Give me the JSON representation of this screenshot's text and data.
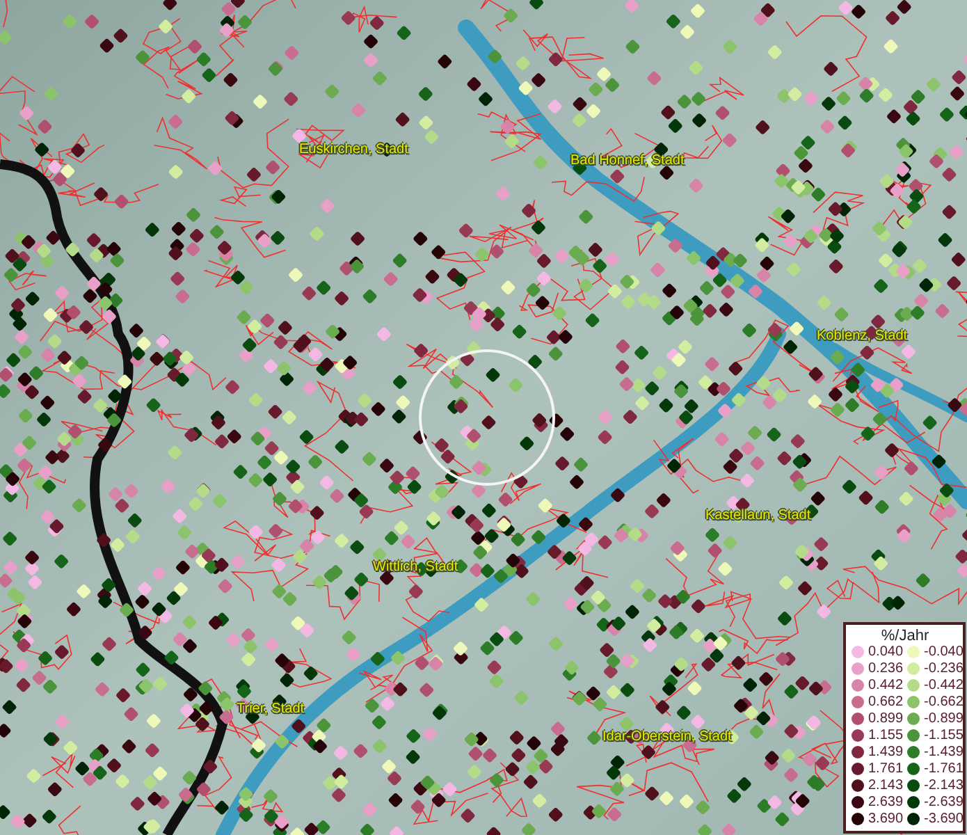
{
  "map": {
    "places": [
      {
        "name": "Euskirchen, Stadt"
      },
      {
        "name": "Bad Honnef, Stadt"
      },
      {
        "name": "Koblenz, Stadt"
      },
      {
        "name": "Kastellaun, Stadt"
      },
      {
        "name": "Wittlich, Stadt"
      },
      {
        "name": "Trier, Stadt"
      },
      {
        "name": "Idar-Oberstein, Stadt"
      }
    ]
  },
  "legend": {
    "title": "%/Jahr",
    "rows": [
      {
        "positive": {
          "value": "0.040",
          "color": "#f4b8e4"
        },
        "negative": {
          "value": "-0.040",
          "color": "#eef8b8"
        }
      },
      {
        "positive": {
          "value": "0.236",
          "color": "#e8a0c8"
        },
        "negative": {
          "value": "-0.236",
          "color": "#d2eca0"
        }
      },
      {
        "positive": {
          "value": "0.442",
          "color": "#d884a8"
        },
        "negative": {
          "value": "-0.442",
          "color": "#b4dc88"
        }
      },
      {
        "positive": {
          "value": "0.662",
          "color": "#c86c90"
        },
        "negative": {
          "value": "-0.662",
          "color": "#8cc46c"
        }
      },
      {
        "positive": {
          "value": "0.899",
          "color": "#b0506e"
        },
        "negative": {
          "value": "-0.899",
          "color": "#6cac50"
        }
      },
      {
        "positive": {
          "value": "1.155",
          "color": "#983a54"
        },
        "negative": {
          "value": "-1.155",
          "color": "#4c943c"
        }
      },
      {
        "positive": {
          "value": "1.439",
          "color": "#802840"
        },
        "negative": {
          "value": "-1.439",
          "color": "#2c7c28"
        }
      },
      {
        "positive": {
          "value": "1.761",
          "color": "#681a2c"
        },
        "negative": {
          "value": "-1.761",
          "color": "#16641a"
        }
      },
      {
        "positive": {
          "value": "2.143",
          "color": "#50101c"
        },
        "negative": {
          "value": "-2.143",
          "color": "#0a4c10"
        }
      },
      {
        "positive": {
          "value": "2.639",
          "color": "#3a0810"
        },
        "negative": {
          "value": "-2.639",
          "color": "#04380a"
        }
      },
      {
        "positive": {
          "value": "3.690",
          "color": "#240406"
        },
        "negative": {
          "value": "-3.690",
          "color": "#022406"
        }
      }
    ]
  }
}
